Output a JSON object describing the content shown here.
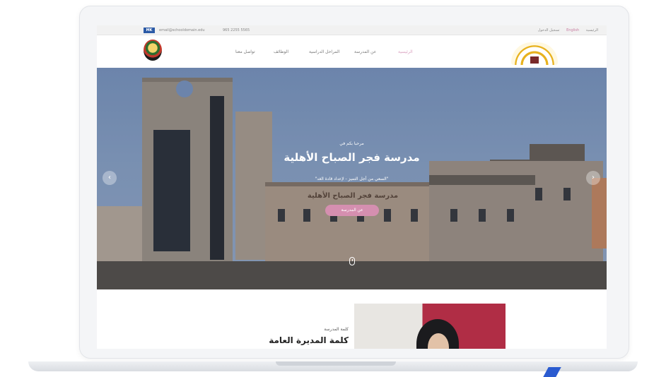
{
  "topbar": {
    "flag_label": "MK",
    "email": "email@schooldomain.edu",
    "phone": "965 2255 5565",
    "lang": "English",
    "login": "تسجيل الدخول",
    "home_link": "الرئيسية"
  },
  "nav": {
    "items": [
      {
        "label": "الرئيسية",
        "active": true
      },
      {
        "label": "عن المدرسة",
        "active": false
      },
      {
        "label": "المراحل الدراسية",
        "active": false
      },
      {
        "label": "الوظائف",
        "active": false
      },
      {
        "label": "تواصل معنا",
        "active": false
      }
    ]
  },
  "hero": {
    "welcome": "مرحبا بكم في",
    "title": "مدرسة فجر الصباح الأهلية",
    "slogan": "\"السعي من أجل التميز - لإعداد قادة الغد\"",
    "engraved": "مدرسة فجر الصباح الأهلية",
    "cta_label": "عن المدرسة",
    "prev": "‹",
    "next": "›"
  },
  "section": {
    "kicker": "كلمة المدرسة",
    "title": "كلمة المديرة العامة"
  },
  "colors": {
    "accent": "#d58fb0",
    "topbar_flag": "#2b5aa6"
  }
}
